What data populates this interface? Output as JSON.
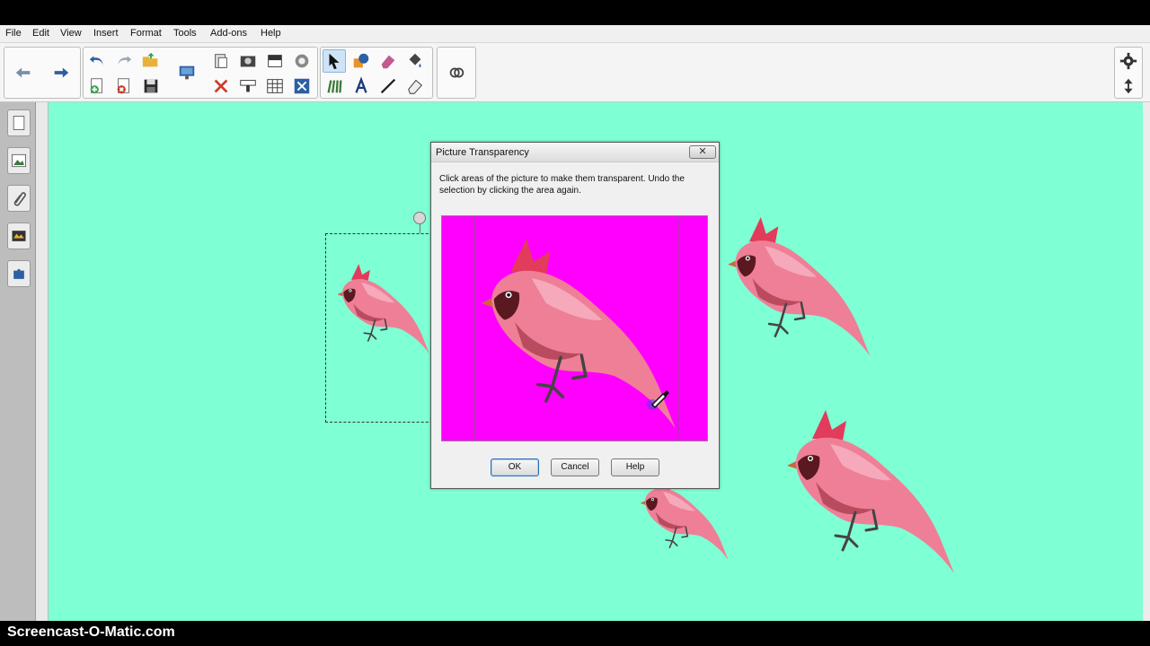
{
  "menu": {
    "file": "File",
    "edit": "Edit",
    "view": "View",
    "insert": "Insert",
    "format": "Format",
    "tools": "Tools",
    "addons": "Add-ons",
    "help": "Help"
  },
  "toolbar": {
    "icons": [
      "back-arrow-icon",
      "forward-arrow-icon",
      "undo-icon",
      "redo-icon",
      "open-folder-icon",
      "new-page-icon",
      "delete-page-icon",
      "save-icon",
      "display-icon",
      "paste-icon",
      "camera-icon",
      "screen-shade-icon",
      "record-icon",
      "cut-icon",
      "clear-icon",
      "document-camera-icon",
      "table-icon",
      "select-icon",
      "shapes-icon",
      "eraser-icon",
      "fill-icon",
      "pens-icon",
      "text-icon",
      "line-icon",
      "eraser-tool-icon",
      "link-icon",
      "settings-icon",
      "move-toolbar-icon"
    ]
  },
  "sidebar": {
    "icons": [
      "page-sorter-icon",
      "gallery-icon",
      "attachments-icon",
      "properties-icon",
      "addons-icon"
    ]
  },
  "dialog": {
    "title": "Picture Transparency",
    "instructions": "Click areas of the picture to make them transparent. Undo the selection by clicking the area again.",
    "ok_label": "OK",
    "cancel_label": "Cancel",
    "help_label": "Help",
    "close_symbol": "✕"
  },
  "watermark": "Screencast-O-Matic.com",
  "colors": {
    "canvas_background": "#7fffd4",
    "preview_background": "#ff00ff",
    "bird": "#e8708a"
  }
}
